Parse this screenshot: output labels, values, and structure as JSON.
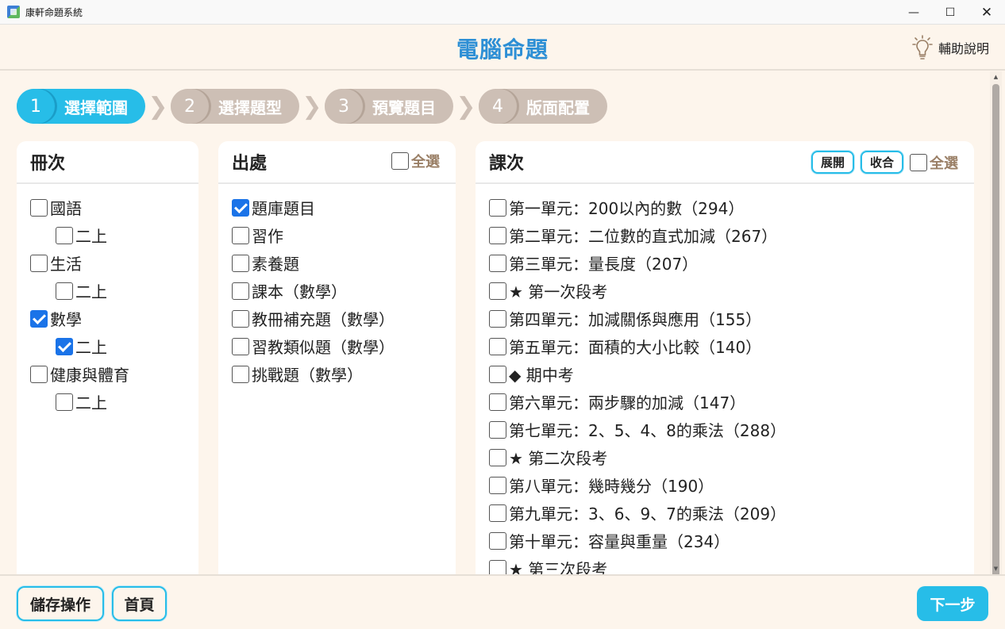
{
  "window": {
    "title": "康軒命題系統",
    "minimize": "—",
    "maximize": "☐",
    "close": "✕"
  },
  "header": {
    "title": "電腦命題",
    "help_label": "輔助說明"
  },
  "steps": [
    {
      "num": "1",
      "label": "選擇範圍",
      "active": true
    },
    {
      "num": "2",
      "label": "選擇題型",
      "active": false
    },
    {
      "num": "3",
      "label": "預覽題目",
      "active": false
    },
    {
      "num": "4",
      "label": "版面配置",
      "active": false
    }
  ],
  "step_arrow": "❯",
  "volume_panel": {
    "title": "冊次",
    "items": [
      {
        "label": "國語",
        "checked": false,
        "level": 0
      },
      {
        "label": "二上",
        "checked": false,
        "level": 1
      },
      {
        "label": "生活",
        "checked": false,
        "level": 0
      },
      {
        "label": "二上",
        "checked": false,
        "level": 1
      },
      {
        "label": "數學",
        "checked": true,
        "level": 0
      },
      {
        "label": "二上",
        "checked": true,
        "level": 1
      },
      {
        "label": "健康與體育",
        "checked": false,
        "level": 0
      },
      {
        "label": "二上",
        "checked": false,
        "level": 1
      }
    ]
  },
  "source_panel": {
    "title": "出處",
    "select_all": "全選",
    "items": [
      {
        "label": "題庫題目",
        "checked": true
      },
      {
        "label": "習作",
        "checked": false
      },
      {
        "label": "素養題",
        "checked": false
      },
      {
        "label": "課本（數學）",
        "checked": false
      },
      {
        "label": "教冊補充題（數學）",
        "checked": false
      },
      {
        "label": "習教類似題（數學）",
        "checked": false
      },
      {
        "label": "挑戰題（數學）",
        "checked": false
      }
    ]
  },
  "lesson_panel": {
    "title": "課次",
    "expand": "展開",
    "collapse": "收合",
    "select_all": "全選",
    "items": [
      {
        "label": "第一單元：200以內的數（294）",
        "checked": false
      },
      {
        "label": "第二單元：二位數的直式加減（267）",
        "checked": false
      },
      {
        "label": "第三單元：量長度（207）",
        "checked": false
      },
      {
        "label": "★ 第一次段考",
        "checked": false
      },
      {
        "label": "第四單元：加減關係與應用（155）",
        "checked": false
      },
      {
        "label": "第五單元：面積的大小比較（140）",
        "checked": false
      },
      {
        "label": "◆ 期中考",
        "checked": false
      },
      {
        "label": "第六單元：兩步驟的加減（147）",
        "checked": false
      },
      {
        "label": "第七單元：2、5、4、8的乘法（288）",
        "checked": false
      },
      {
        "label": "★ 第二次段考",
        "checked": false
      },
      {
        "label": "第八單元：幾時幾分（190）",
        "checked": false
      },
      {
        "label": "第九單元：3、6、9、7的乘法（209）",
        "checked": false
      },
      {
        "label": "第十單元：容量與重量（234）",
        "checked": false
      },
      {
        "label": "★ 第三次段考",
        "checked": false
      }
    ]
  },
  "footer": {
    "save_label": "儲存操作",
    "home_label": "首頁",
    "next_label": "下一步"
  },
  "colors": {
    "accent": "#27bde8",
    "title_blue": "#2d8fd5",
    "inactive_step": "#cdbfb5",
    "background": "#fdf5ec",
    "checkbox_checked": "#1a73e8",
    "select_all_text": "#9a7f66"
  }
}
